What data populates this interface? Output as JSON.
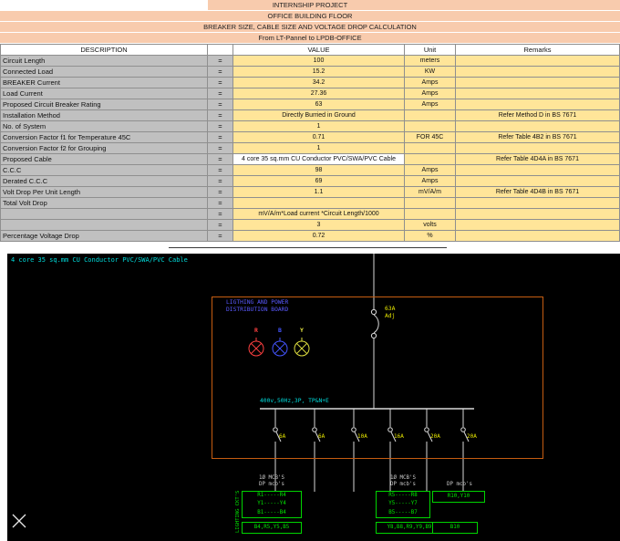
{
  "table": {
    "bands": [
      "INTERNSHIP PROJECT",
      "OFFICE BUILDING FLOOR",
      "BREAKER SIZE, CABLE SIZE AND VOLTAGE DROP CALCULATION",
      "From LT-Pannel to LPDB-OFFICE"
    ],
    "headers": {
      "description": "DESCRIPTION",
      "eq": "",
      "value": "VALUE",
      "unit": "Unit",
      "remarks": "Remarks"
    },
    "rows": [
      {
        "description": "Circuit Length",
        "eq": "=",
        "value": "100",
        "unit": "meters",
        "remarks": ""
      },
      {
        "description": "Connected Load",
        "eq": "=",
        "value": "15.2",
        "unit": "KW",
        "remarks": ""
      },
      {
        "description": "BREAKER Current",
        "eq": "=",
        "value": "34.2",
        "unit": "Amps",
        "remarks": ""
      },
      {
        "description": "Load Current",
        "eq": "=",
        "value": "27.36",
        "unit": "Amps",
        "remarks": ""
      },
      {
        "description": "Proposed Circuit Breaker Rating",
        "eq": "=",
        "value": "63",
        "unit": "Amps",
        "remarks": ""
      },
      {
        "description": "Installation Method",
        "eq": "=",
        "value": "Directly Burried in Ground",
        "unit": "",
        "remarks": "Refer Method D in BS 7671"
      },
      {
        "description": "No. of System",
        "eq": "=",
        "value": "1",
        "unit": "",
        "remarks": ""
      },
      {
        "description": "Conversion Factor f1 for Temperature 45C",
        "eq": "=",
        "value": "0.71",
        "unit": "FOR 45C",
        "remarks": "Refer Table 4B2 in BS 7671"
      },
      {
        "description": "Conversion Factor f2 for Grouping",
        "eq": "=",
        "value": "1",
        "unit": "",
        "remarks": ""
      },
      {
        "description": "Proposed Cable",
        "eq": "=",
        "value": "4 core 35 sq.mm CU Conductor PVC/SWA/PVC Cable",
        "unit": "",
        "remarks": "Refer Table 4D4A in BS 7671",
        "value_bg": "#ffffff"
      },
      {
        "description": "C.C.C",
        "eq": "=",
        "value": "98",
        "unit": "Amps",
        "remarks": ""
      },
      {
        "description": "Derated C.C.C",
        "eq": "=",
        "value": "69",
        "unit": "Amps",
        "remarks": ""
      },
      {
        "description": "Volt Drop Per Unit Length",
        "eq": "=",
        "value": "1.1",
        "unit": "mV/A/m",
        "remarks": "Refer Table 4D4B in BS 7671"
      },
      {
        "description": "Total Volt Drop",
        "eq": "=",
        "value": "",
        "unit": "",
        "remarks": ""
      },
      {
        "description": "",
        "eq": "=",
        "value": "mV/A/m*Load current *Circuit Length/1000",
        "unit": "",
        "remarks": ""
      },
      {
        "description": "",
        "eq": "=",
        "value": "3",
        "unit": "volts",
        "remarks": ""
      },
      {
        "description": "Percentage Voltage Drop",
        "eq": "=",
        "value": "0.72",
        "unit": "%",
        "remarks": ""
      }
    ],
    "colors": {
      "band_bg": "#f8cbad",
      "desc_bg": "#c0c0c0",
      "value_bg": "#ffe599",
      "grid": "#8f8f8f"
    }
  },
  "drawing": {
    "cable_label": "4 core 35 sq.mm CU Conductor PVC/SWA/PVC Cable",
    "board_name": {
      "line1": "LIGTHING AND POWER",
      "line2": "DISTRIBUTION BOARD"
    },
    "main_breaker": {
      "line1": "63A",
      "line2": "Adj"
    },
    "bus_label": "400v,50Hz,3P, TP&N+E",
    "lamps": [
      {
        "label": "R",
        "color": "#ff4040"
      },
      {
        "label": "B",
        "color": "#4455ff"
      },
      {
        "label": "Y",
        "color": "#e0e040"
      }
    ],
    "branches": [
      {
        "rating": "6A"
      },
      {
        "rating": "6A"
      },
      {
        "rating": "10A"
      },
      {
        "rating": "16A"
      },
      {
        "rating": "20A"
      },
      {
        "rating": "20A"
      }
    ],
    "groups": [
      {
        "header_line1": "1Ø MCB'S",
        "header_line2": "DP mcb's",
        "circuits": [
          "R1-----R4",
          "Y1-----Y4",
          "B1-----B4"
        ],
        "footer": "B4,R5,Y5,B5"
      },
      {
        "header_line1": "1Ø MCB'S",
        "header_line2": "DP mcb's",
        "circuits": [
          "R5-----R8",
          "Y5-----Y7",
          "B5-----B7"
        ],
        "footer": "Y8,B8,R9,Y9,B9"
      },
      {
        "header_line1": "DP mcb's",
        "header_line2": "",
        "circuits": [
          "R10,Y10"
        ],
        "footer": "B10"
      }
    ],
    "side_label": "LIGHTING CKT'S",
    "colors": {
      "line": "#d9d9d9",
      "cyan": "#00dcdc",
      "yellow": "#e8e800",
      "green": "#00d400",
      "green_text": "#00e600",
      "board": "#c65d11",
      "blue": "#5a5aff",
      "gray_label": "#c8c8c8"
    }
  }
}
